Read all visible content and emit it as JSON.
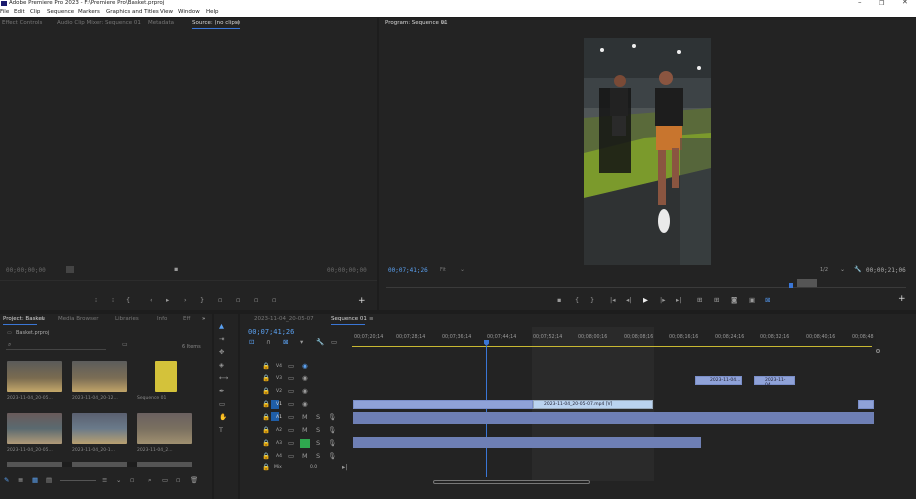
{
  "titlebar": {
    "title": "Adobe Premiere Pro 2023 - F:\\Premiere Pro\\Basket.prproj"
  },
  "menu": [
    "File",
    "Edit",
    "Clip",
    "Sequence",
    "Markers",
    "Graphics and Titles",
    "View",
    "Window",
    "Help"
  ],
  "source_panel": {
    "tabs": [
      "Effect Controls",
      "Audio Clip Mixer: Sequence 01",
      "Metadata",
      "Source: (no clips)"
    ],
    "timecode_left": "00;00;00;00",
    "timecode_right": "00;00;00;00"
  },
  "program_panel": {
    "tab": "Program: Sequence 01",
    "timecode": "00;07;41;26",
    "fit": "Fit",
    "quality": "1/2",
    "duration": "00;00;21;06"
  },
  "project_panel": {
    "tabs": [
      "Project: Basket",
      "Media Browser",
      "Libraries",
      "Info",
      "Eff"
    ],
    "file": "Basket.prproj",
    "items_count": "6 Items",
    "items": [
      {
        "label": "2023-11-04_20-05..."
      },
      {
        "label": "2023-11-04_20-12..."
      },
      {
        "label": "Sequence 01"
      },
      {
        "label": "2023-11-04_20-05..."
      },
      {
        "label": "2023-11-04_20-1..."
      },
      {
        "label": "2023-11-04_2..."
      }
    ]
  },
  "timeline": {
    "tabs": [
      "2023-11-04_20-05-07",
      "Sequence 01"
    ],
    "timecode": "00;07;41;26",
    "ruler": [
      "00;07;20;14",
      "00;07;28;14",
      "00;07;36;14",
      "00;07;44;14",
      "00;07;52;14",
      "00;08;00;16",
      "00;08;08;16",
      "00;08;16;16",
      "00;08;24;16",
      "00;08;32;16",
      "00;08;40;16",
      "00;08;48"
    ],
    "video_tracks": [
      "V4",
      "V3",
      "V2",
      "V1"
    ],
    "audio_tracks": [
      "A1",
      "A2",
      "A3",
      "A4"
    ],
    "mix": "Mix",
    "mix_value": "0.0",
    "selected_clip": "2023-11-04_20-05-07.mp4 [V]",
    "clip_small": "2023-11-04..."
  },
  "colors": {
    "accent": "#3a76d6",
    "clip_video": "#8fa2d8",
    "clip_audio": "#6e7fb5",
    "playhead": "#3a76d6"
  }
}
